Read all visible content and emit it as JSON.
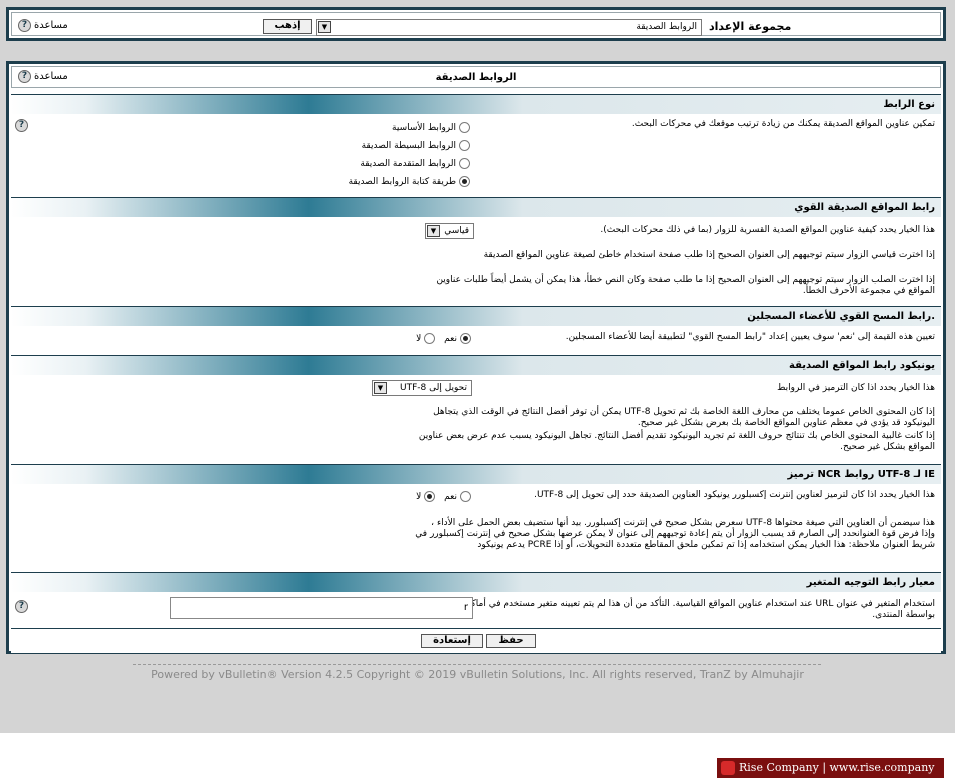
{
  "top": {
    "setting_group_label": "مجموعة الإعداد",
    "selected_group": "الروابط الصديقة",
    "go_label": "إذهب",
    "help_label": "مساعدة"
  },
  "panel": {
    "title": "الروابط الصديقة",
    "help_label": "مساعدة"
  },
  "sections": {
    "link_type": {
      "heading": "نوع الرابط",
      "description": "تمكين عناوين المواقع الصديقة يمكنك من زيادة ترتيب موقعك في محركات البحث.",
      "options": [
        "الروابط الأساسية",
        "الروابط البسيطة الصديقة",
        "الروابط المتقدمة الصديقة",
        "طريقة كتابة الروابط الصديقة"
      ],
      "selected_index": 3
    },
    "strong_link": {
      "heading": "رابط المواقع الصديقة القوي",
      "desc1": "هذا الخيار يحدد كيفية عناوين المواقع الصدية القسرية للزوار (بما في ذلك محركات البحث).",
      "desc2": "إذا اخترت قياسي الزوار سيتم توجيههم إلى العنوان الصحيح إذا طلب صفحة استخدام خاطئ لصيغة عناوين المواقع الصديقة",
      "desc3": "إذا اخترت الصلب الزوار سيتم توجيههم إلى العنوان الصحيح إذا ما طلب صفحة وكان النص خطأ، هذا يمكن أن يشمل أيضاً طلبات عناوين المواقع في مجموعة الأحرف الخطأ.",
      "select_value": "قياسي"
    },
    "strong_scan": {
      "heading": "رابط المسح القوي للأعضاء المسجلين.",
      "description": "تعيين هذه القيمة إلى 'نعم' سوف يعيين إعداد \"رابط المسح القوي\" لتطبيقة أيضا للأعضاء المسجلين.",
      "yes_label": "نعم",
      "no_label": "لا"
    },
    "unicode": {
      "heading": "يونيكود رابط المواقع الصديقة",
      "desc1": "هذا الخيار يحدد اذا كان الترميز في الروابط",
      "desc2": "إذا كان المحتوى الخاص عموما يختلف من محارف اللغة الخاصة بك ثم تحويل UTF-8 يمكن أن توفر أفضل النتائج في الوقت الذي يتجاهل اليونيكود قد يؤدي في معظم عناوين المواقع الخاصة بك بعرض بشكل غير صحيح.",
      "desc3": "إذا كانت غالبية المحتوى الخاص بك تنتائج حروف اللغة ثم تجريد اليونيكود تقديم أفضل النتائج. تجاهل اليونيكود يسبب عدم عرض بعض عناوين المواقع بشكل غير صحيح.",
      "select_value": "تحويل إلى UTF-8"
    },
    "ncr": {
      "heading": "ترميز NCR روابط UTF-8 لـ IE",
      "desc1": "هذا الخيار يحدد اذا كان لترميز لعناوين إنترنت إكسبلورر يونيكود العناوين الصديقة حدد إلى تحويل إلى UTF-8.",
      "desc2": "هذا سيضمن أن العناوين التي صيغة محتواها UTF-8 سعرض بشكل صحيح في إنترنت إكسبلورر. بيد أنها ستضيف بعض الحمل على الأداء ، وإذا فرض قوة العنوانحدد إلى الصارم قد يسبب الزوار أن يتم إعادة توجيههم إلى عنوان لا يمكن عرضها بشكل صحيح في إنترنت إكسبلورر في شريط العنوان ملاحظة: هذا الخيار يمكن استخدامه إذا تم تمكين ملحق المقاطع متعددة التحويلات، أو إذا PCRE يدعم يونيكود",
      "yes_label": "نعم",
      "no_label": "لا"
    },
    "variable": {
      "heading": "معيار رابط التوجيه المتغير",
      "description": "استخدام المتغير في عنوان URL عند استخدام عناوين المواقع القياسية. التأكد من أن هذا لم يتم تعيينه متغير مستخدم في أماكن أخرى بواسطة المنتدى.",
      "input_value": "r"
    }
  },
  "buttons": {
    "save": "حفظ",
    "reset": "إستعادة"
  },
  "footer": {
    "text": "Powered by vBulletin® Version 4.2.5 Copyright © 2019 vBulletin Solutions, Inc. All rights reserved, TranZ by Almuhajir"
  },
  "brand": {
    "text": "Rise Company | www.rise.company"
  }
}
